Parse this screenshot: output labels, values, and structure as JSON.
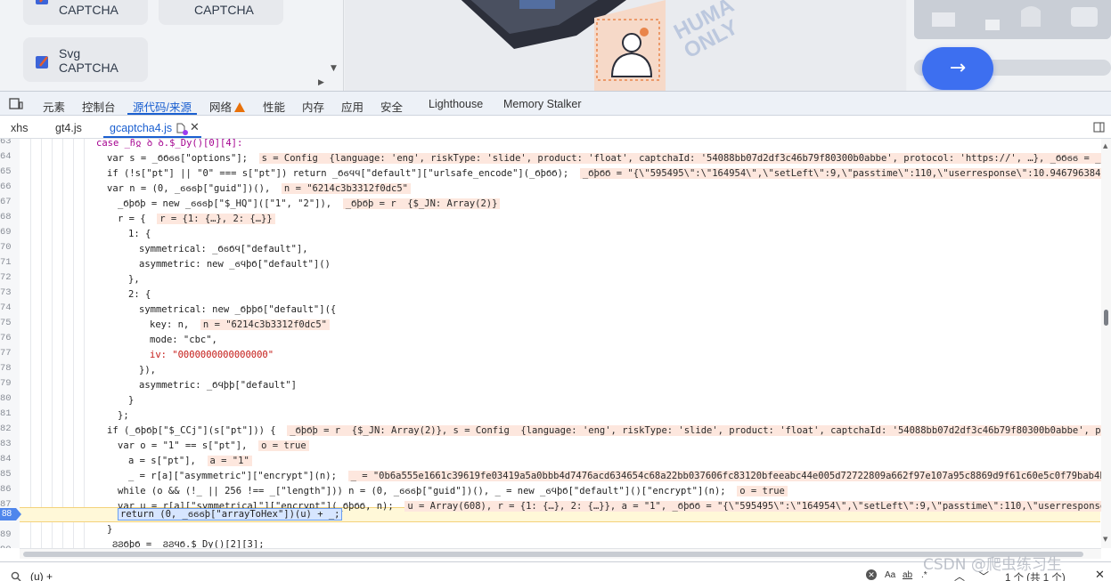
{
  "page": {
    "cards": [
      {
        "line1": "",
        "line2": "CAPTCHA"
      },
      {
        "line1": "",
        "line2": "CAPTCHA"
      },
      {
        "line1": "Svg",
        "line2": "CAPTCHA"
      }
    ],
    "art_text": "HUMA ONLY",
    "slider_arrow": "→"
  },
  "devtools": {
    "tabs": [
      "元素",
      "控制台",
      "源代码/来源",
      "网络",
      "性能",
      "内存",
      "应用",
      "安全",
      "Lighthouse",
      "Memory Stalker"
    ],
    "active_tab": "源代码/来源",
    "files": [
      "xhs",
      "gt4.js",
      "gcaptcha4.js"
    ],
    "active_file": "gcaptcha4.js"
  },
  "code": {
    "lines": [
      {
        "n": "63",
        "text": "case _ჩჲ ꝺ ꝺ.$_Dy()[0][4]:"
      },
      {
        "n": "64",
        "text": "var s = _ϬϬϭϭ[\"options\"];",
        "inline": "s = Config  {language: 'eng', riskType: 'slide', product: 'float', captchaId: '54088bb07d2df3c46b79f80300b0abbe', protocol: 'https://', …}, _ϬϬϭϭ = _ϬϬ"
      },
      {
        "n": "65",
        "text": "if (!s[\"pt\"] || \"0\" === s[\"pt\"]) return _ϬϭϤϤ[\"default\"][\"urlsafe_encode\"](_ϬϸϬϬ);",
        "inline": "_ϬϸϬϬ = \"{\\\"595495\\\":\\\"164954\\\",\\\"setLeft\\\":9,\\\"passtime\\\":110,\\\"userresponse\\\":10.946796384168"
      },
      {
        "n": "66",
        "text": "var n = (0, _ϭϭϭϸ[\"guid\"])(),",
        "inline": "n = \"6214c3b3312f0dc5\""
      },
      {
        "n": "67",
        "text": "_ϬϸϬϸ = new _ϭϭϭϸ[\"$_HQ\"]([\"1\", \"2\"]),",
        "inline": "_ϬϸϬϸ = r  {$_JN: Array(2)}"
      },
      {
        "n": "68",
        "text": "r = {",
        "inline": "r = {1: {…}, 2: {…}}"
      },
      {
        "n": "69",
        "text": "1: {"
      },
      {
        "n": "70",
        "text": "symmetrical: _ϬϭϬϤ[\"default\"],"
      },
      {
        "n": "71",
        "text": "asymmetric: new _ϭϤϸϬ[\"default\"]()"
      },
      {
        "n": "72",
        "text": "},"
      },
      {
        "n": "73",
        "text": "2: {"
      },
      {
        "n": "74",
        "text": "symmetrical: new _ϬϸϸϬ[\"default\"]({"
      },
      {
        "n": "75",
        "text": "key: n,",
        "inline": "n = \"6214c3b3312f0dc5\""
      },
      {
        "n": "76",
        "text": "mode: \"cbc\","
      },
      {
        "n": "77",
        "text": "iv: \"0000000000000000\""
      },
      {
        "n": "78",
        "text": "}),"
      },
      {
        "n": "79",
        "text": "asymmetric: _ϬϤϸϸ[\"default\"]"
      },
      {
        "n": "80",
        "text": "}"
      },
      {
        "n": "81",
        "text": "};"
      },
      {
        "n": "82",
        "text": "if (_ϬϸϬϸ[\"$_CCj\"](s[\"pt\"])) {",
        "inline": "_ϬϸϬϸ = r  {$_JN: Array(2)}, s = Config  {language: 'eng', riskType: 'slide', product: 'float', captchaId: '54088bb07d2df3c46b79f80300b0abbe', protocol"
      },
      {
        "n": "83",
        "text": "var o = \"1\" == s[\"pt\"],",
        "inline": "o = true"
      },
      {
        "n": "84",
        "text": "a = s[\"pt\"],",
        "inline": "a = \"1\""
      },
      {
        "n": "85",
        "text": "_ = r[a][\"asymmetric\"][\"encrypt\"](n);",
        "inline": "_ = \"0b6a555e1661c39619fe03419a5a0bbb4d7476acd634654c68a22bb037606fc83120bfeeabc44e005d72722809a662f97e107a95c8869d9f61c60e5c0f79bab4b33d49eb4"
      },
      {
        "n": "86",
        "text": "while (o && (!_ || 256 !== _[\"length\"])) n = (0, _ϭϭϭϸ[\"guid\"])(), _ = new _ϭϤϸϬ[\"default\"]()[\"encrypt\"](n);",
        "inline": "o = true"
      },
      {
        "n": "87",
        "text": "var u = r[a][\"symmetrical\"][\"encrypt\"](_ϬϸϬϬ, n);",
        "inline": "u = Array(608), r = {1: {…}, 2: {…}}, a = \"1\", _ϬϸϬϬ = \"{\\\"595495\\\":\\\"164954\\\",\\\"setLeft\\\":9,\\\"passtime\\\":110,\\\"userresponse\\\""
      },
      {
        "n": "88",
        "text": "return (0, _ϭϭϭϸ[\"arrayToHex\"])(u) + _;"
      },
      {
        "n": "89",
        "text": "}"
      },
      {
        "n": "90",
        "text": "ϨϨϬϸϬ =  ϨϨϤϬ.$_Dy()[2][3];"
      }
    ]
  },
  "search": {
    "query": "(u) +",
    "status": "1 个 (共 1 个)",
    "aa": "Aa",
    "ab": "ab",
    "regex": ".*"
  },
  "watermark": "CSDN @爬虫练习生"
}
